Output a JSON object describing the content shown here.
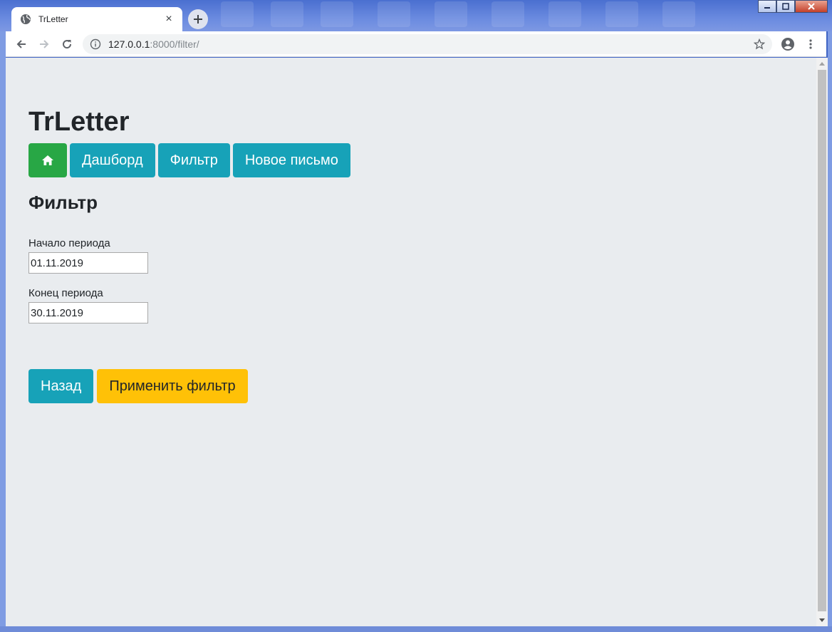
{
  "browser": {
    "tab_title": "TrLetter",
    "tab_close": "×",
    "new_tab": "+",
    "url_host": "127.0.0.1",
    "url_rest": ":8000/filter/"
  },
  "page": {
    "brand": "TrLetter",
    "nav": {
      "home_icon": "home-icon",
      "dashboard": "Дашборд",
      "filter": "Фильтр",
      "new_letter": "Новое письмо"
    },
    "heading": "Фильтр",
    "form": {
      "start_label": "Начало периода",
      "start_value": "01.11.2019",
      "end_label": "Конец периода",
      "end_value": "30.11.2019"
    },
    "actions": {
      "back": "Назад",
      "apply": "Применить фильтр"
    }
  },
  "colors": {
    "success": "#28a745",
    "info": "#17a2b8",
    "warning": "#ffc107",
    "page_bg": "#e9ecef"
  }
}
